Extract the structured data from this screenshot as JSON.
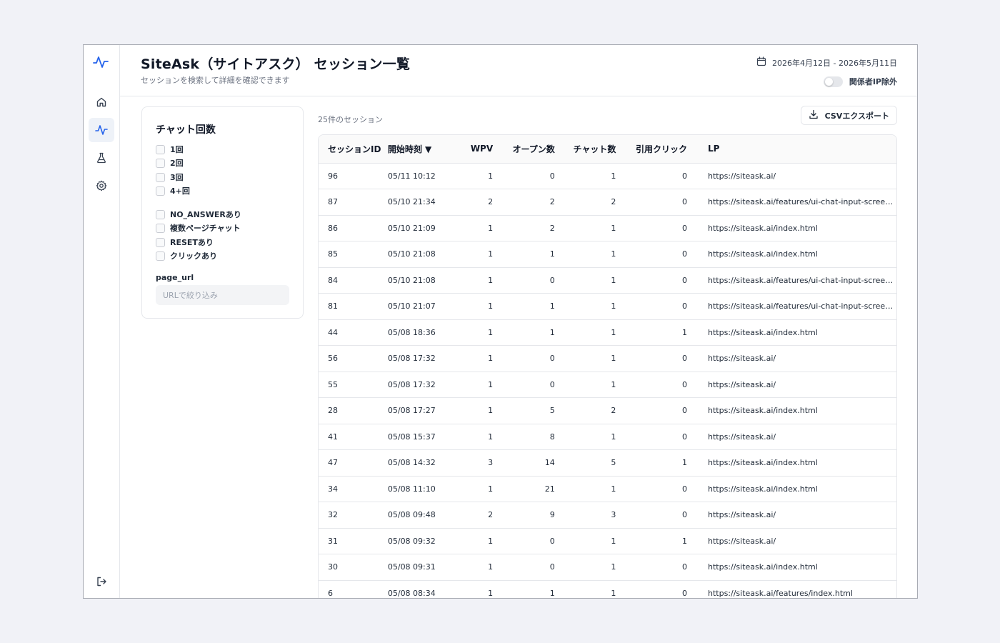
{
  "app": {
    "title": "SiteAsk（サイトアスク） セッション一覧",
    "subtitle": "セッションを検索して詳細を確認できます",
    "date_range": "2026年4月12日 - 2026年5月11日",
    "toggle_label": "関係者IP除外",
    "toggle_on": false
  },
  "sidebar": {
    "items": [
      {
        "icon": "home-icon",
        "active": false
      },
      {
        "icon": "activity-icon",
        "active": true
      },
      {
        "icon": "flask-icon",
        "active": false
      },
      {
        "icon": "gear-icon",
        "active": false
      }
    ],
    "logout_icon": "logout-icon"
  },
  "filters": {
    "title": "チャット回数",
    "chat_counts": [
      "1回",
      "2回",
      "3回",
      "4+回"
    ],
    "flags": [
      "NO_ANSWERあり",
      "複数ページチャット",
      "RESETあり",
      "クリックあり"
    ],
    "page_url_label": "page_url",
    "page_url_placeholder": "URLで絞り込み"
  },
  "results": {
    "count_text": "25件のセッション",
    "export_label": "CSVエクスポート"
  },
  "table": {
    "headers": {
      "id": "セッションID",
      "time": "開始時刻 ▼",
      "wpv": "WPV",
      "open": "オープン数",
      "chat": "チャット数",
      "cite": "引用クリック",
      "lp": "LP"
    },
    "rows": [
      {
        "id": "96",
        "time": "05/11 10:12",
        "wpv": "1",
        "open": "0",
        "chat": "1",
        "cite": "0",
        "lp": "https://siteask.ai/"
      },
      {
        "id": "87",
        "time": "05/10 21:34",
        "wpv": "2",
        "open": "2",
        "chat": "2",
        "cite": "0",
        "lp": "https://siteask.ai/features/ui-chat-input-screen.h..."
      },
      {
        "id": "86",
        "time": "05/10 21:09",
        "wpv": "1",
        "open": "2",
        "chat": "1",
        "cite": "0",
        "lp": "https://siteask.ai/index.html"
      },
      {
        "id": "85",
        "time": "05/10 21:08",
        "wpv": "1",
        "open": "1",
        "chat": "1",
        "cite": "0",
        "lp": "https://siteask.ai/index.html"
      },
      {
        "id": "84",
        "time": "05/10 21:08",
        "wpv": "1",
        "open": "0",
        "chat": "1",
        "cite": "0",
        "lp": "https://siteask.ai/features/ui-chat-input-screen.h..."
      },
      {
        "id": "81",
        "time": "05/10 21:07",
        "wpv": "1",
        "open": "1",
        "chat": "1",
        "cite": "0",
        "lp": "https://siteask.ai/features/ui-chat-input-screen.h..."
      },
      {
        "id": "44",
        "time": "05/08 18:36",
        "wpv": "1",
        "open": "1",
        "chat": "1",
        "cite": "1",
        "lp": "https://siteask.ai/index.html"
      },
      {
        "id": "56",
        "time": "05/08 17:32",
        "wpv": "1",
        "open": "0",
        "chat": "1",
        "cite": "0",
        "lp": "https://siteask.ai/"
      },
      {
        "id": "55",
        "time": "05/08 17:32",
        "wpv": "1",
        "open": "0",
        "chat": "1",
        "cite": "0",
        "lp": "https://siteask.ai/"
      },
      {
        "id": "28",
        "time": "05/08 17:27",
        "wpv": "1",
        "open": "5",
        "chat": "2",
        "cite": "0",
        "lp": "https://siteask.ai/index.html"
      },
      {
        "id": "41",
        "time": "05/08 15:37",
        "wpv": "1",
        "open": "8",
        "chat": "1",
        "cite": "0",
        "lp": "https://siteask.ai/"
      },
      {
        "id": "47",
        "time": "05/08 14:32",
        "wpv": "3",
        "open": "14",
        "chat": "5",
        "cite": "1",
        "lp": "https://siteask.ai/index.html"
      },
      {
        "id": "34",
        "time": "05/08 11:10",
        "wpv": "1",
        "open": "21",
        "chat": "1",
        "cite": "0",
        "lp": "https://siteask.ai/index.html"
      },
      {
        "id": "32",
        "time": "05/08 09:48",
        "wpv": "2",
        "open": "9",
        "chat": "3",
        "cite": "0",
        "lp": "https://siteask.ai/"
      },
      {
        "id": "31",
        "time": "05/08 09:32",
        "wpv": "1",
        "open": "0",
        "chat": "1",
        "cite": "1",
        "lp": "https://siteask.ai/"
      },
      {
        "id": "30",
        "time": "05/08 09:31",
        "wpv": "1",
        "open": "0",
        "chat": "1",
        "cite": "0",
        "lp": "https://siteask.ai/index.html"
      },
      {
        "id": "6",
        "time": "05/08 08:34",
        "wpv": "1",
        "open": "1",
        "chat": "1",
        "cite": "0",
        "lp": "https://siteask.ai/features/index.html"
      }
    ]
  },
  "colors": {
    "accent": "#2563eb",
    "active_nav_bg": "#eef2f8",
    "border": "#e5e7eb",
    "page_bg": "#f1f2f7"
  }
}
